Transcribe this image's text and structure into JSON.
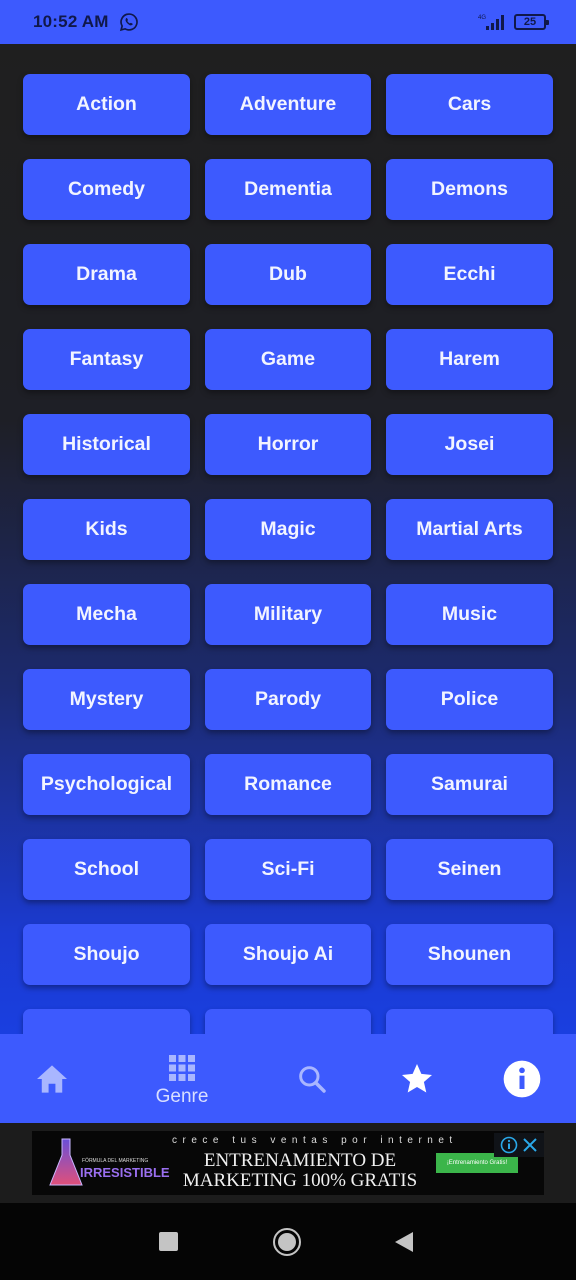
{
  "status_bar": {
    "time": "10:52 AM",
    "notification_icon": "whatsapp-icon",
    "network": "4G",
    "battery": "25"
  },
  "genres": [
    "Action",
    "Adventure",
    "Cars",
    "Comedy",
    "Dementia",
    "Demons",
    "Drama",
    "Dub",
    "Ecchi",
    "Fantasy",
    "Game",
    "Harem",
    "Historical",
    "Horror",
    "Josei",
    "Kids",
    "Magic",
    "Martial Arts",
    "Mecha",
    "Military",
    "Music",
    "Mystery",
    "Parody",
    "Police",
    "Psychological",
    "Romance",
    "Samurai",
    "School",
    "Sci-Fi",
    "Seinen",
    "Shoujo",
    "Shoujo Ai",
    "Shounen",
    "",
    "",
    ""
  ],
  "bottom_nav": {
    "items": [
      {
        "icon": "home-icon",
        "label": ""
      },
      {
        "icon": "grid-icon",
        "label": "Genre",
        "active": true
      },
      {
        "icon": "search-icon",
        "label": ""
      },
      {
        "icon": "star-icon",
        "label": ""
      },
      {
        "icon": "info-icon",
        "label": ""
      }
    ]
  },
  "ad": {
    "tagline": "crece tus ventas por internet",
    "headline_line1": "ENTRENAMIENTO DE",
    "headline_line2": "MARKETING 100% GRATIS",
    "logo_line1": "FÓRMULA DEL MARKETING",
    "logo_line2": "IRRESISTIBLE",
    "cta": "¡Entrenamiento Gratis!"
  },
  "colors": {
    "accent": "#3d5afe",
    "background_top": "#1f1f1f",
    "background_bottom": "#1a3fe0"
  }
}
